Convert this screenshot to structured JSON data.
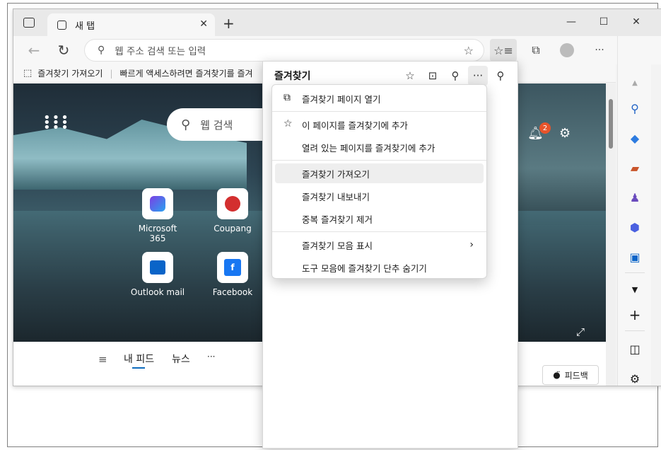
{
  "tab": {
    "title": "새 탭"
  },
  "window_controls": {
    "minimize": "—",
    "maximize": "☐",
    "close": "✕"
  },
  "address": {
    "placeholder": "웹 주소 검색 또는 입력"
  },
  "favorites_bar": {
    "import": "즐겨찾기 가져오기",
    "hint": "빠르게 액세스하려면 즐겨찾기를 즐겨"
  },
  "newtab": {
    "search_placeholder": "웹 검색",
    "tiles": [
      {
        "label": "Microsoft 365"
      },
      {
        "label": "Coupang"
      },
      {
        "label": "Outlook mail"
      },
      {
        "label": "Facebook"
      }
    ],
    "notification_count": "2",
    "feed_tabs": [
      "내 피드",
      "뉴스",
      "···"
    ],
    "feedback": "피드백"
  },
  "favorites_panel": {
    "title": "즐겨찾기",
    "menu": [
      {
        "label": "즐겨찾기 페이지 열기",
        "icon": "external-link-icon"
      },
      {
        "label": "이 페이지를 즐겨찾기에 추가",
        "icon": "star-add-icon"
      },
      {
        "label": "열려 있는 페이지를 즐겨찾기에 추가",
        "icon": ""
      },
      {
        "label": "즐겨찾기 가져오기",
        "icon": "",
        "highlighted": true
      },
      {
        "label": "즐겨찾기 내보내기",
        "icon": ""
      },
      {
        "label": "중복 즐겨찾기 제거",
        "icon": ""
      },
      {
        "label": "즐겨찾기 모음 표시",
        "icon": "",
        "submenu": true
      },
      {
        "label": "도구 모음에 즐겨찾기 단추 숨기기",
        "icon": ""
      }
    ]
  },
  "colors": {
    "accent": "#0f6cbd",
    "highlight": "#eeeeee",
    "badge": "#e8542b"
  }
}
